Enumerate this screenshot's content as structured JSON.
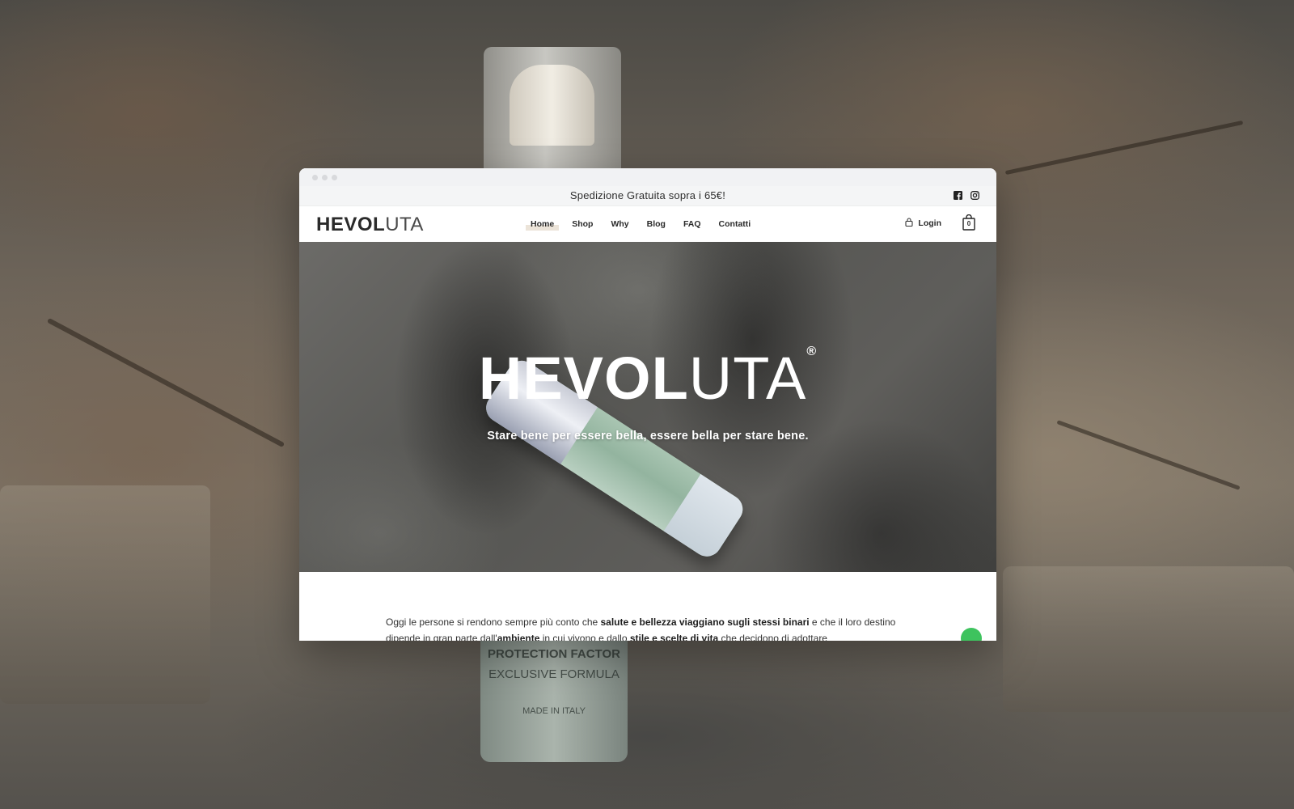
{
  "topbar": {
    "promo": "Spedizione Gratuita sopra i 65€!",
    "social_icons": [
      "facebook-icon",
      "instagram-icon"
    ]
  },
  "logo": {
    "bold": "HEVOL",
    "light": "UTA"
  },
  "nav": {
    "items": [
      {
        "label": "Home",
        "active": true
      },
      {
        "label": "Shop",
        "active": false
      },
      {
        "label": "Why",
        "active": false
      },
      {
        "label": "Blog",
        "active": false
      },
      {
        "label": "FAQ",
        "active": false
      },
      {
        "label": "Contatti",
        "active": false
      }
    ],
    "login_label": "Login",
    "cart_count": "0"
  },
  "hero": {
    "title_bold": "HEVOL",
    "title_light": "UTA",
    "trademark": "®",
    "tagline": "Stare bene per essere bella, essere bella per stare bene."
  },
  "content": {
    "line1_a": "Oggi le persone si rendono sempre più conto che ",
    "line1_b": "salute e bellezza viaggiano sugli stessi binari",
    "line1_c": " e che il loro destino",
    "line2_a": "dipende in gran parte dall'",
    "line2_b": "ambiente",
    "line2_c": " in cui vivono e dallo ",
    "line2_d": "stile e scelte di vita",
    "line2_e": " che decidono di adottare"
  },
  "background_bottle": {
    "line1": "PROTECTION FACTOR",
    "line2": "EXCLUSIVE FORMULA",
    "line3": "MADE IN ITALY"
  },
  "colors": {
    "accent_highlight": "#ece4d9",
    "chat_green": "#3ec35e",
    "text_dark": "#2a2a2a"
  }
}
